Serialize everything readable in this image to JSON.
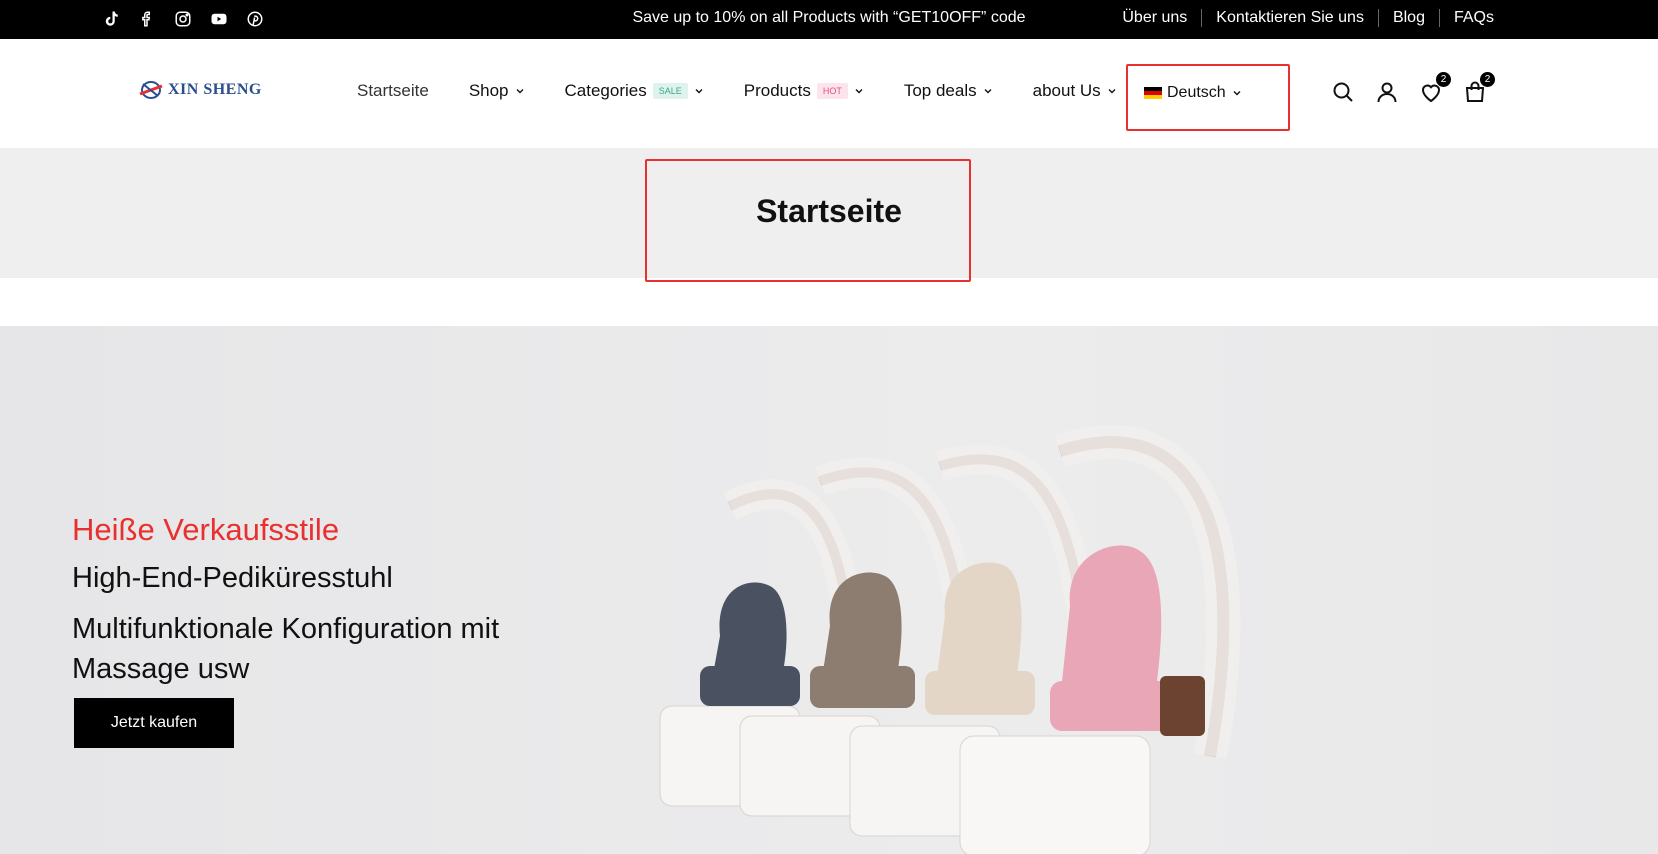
{
  "topbar": {
    "social_icons": [
      "tiktok-icon",
      "facebook-icon",
      "instagram-icon",
      "youtube-icon",
      "pinterest-icon"
    ],
    "promo": "Save up to 10% on all Products with “GET10OFF” code",
    "links": [
      "Über uns",
      "Kontaktieren Sie uns",
      "Blog",
      "FAQs"
    ]
  },
  "header": {
    "logo_text": "XIN SHENG",
    "nav": [
      {
        "label": "Startseite"
      },
      {
        "label": "Shop"
      },
      {
        "label": "Categories",
        "tag": "SALE"
      },
      {
        "label": "Products",
        "tag": "HOT"
      },
      {
        "label": "Top deals"
      },
      {
        "label": "about Us"
      }
    ],
    "language": "Deutsch",
    "wishlist_count": "2",
    "cart_count": "2"
  },
  "page": {
    "title": "Startseite"
  },
  "hero": {
    "subtitle": "Heiße Verkaufsstile",
    "heading1": "High-End-Pediküresstuhl",
    "heading2": "Multifunktionale Konfiguration mit Massage usw",
    "cta": "Jetzt kaufen"
  },
  "colors": {
    "accent_red": "#e8312f",
    "brand_blue": "#2a4d8f",
    "sale_tag": "#3aa68a",
    "hot_tag": "#e0557a"
  }
}
